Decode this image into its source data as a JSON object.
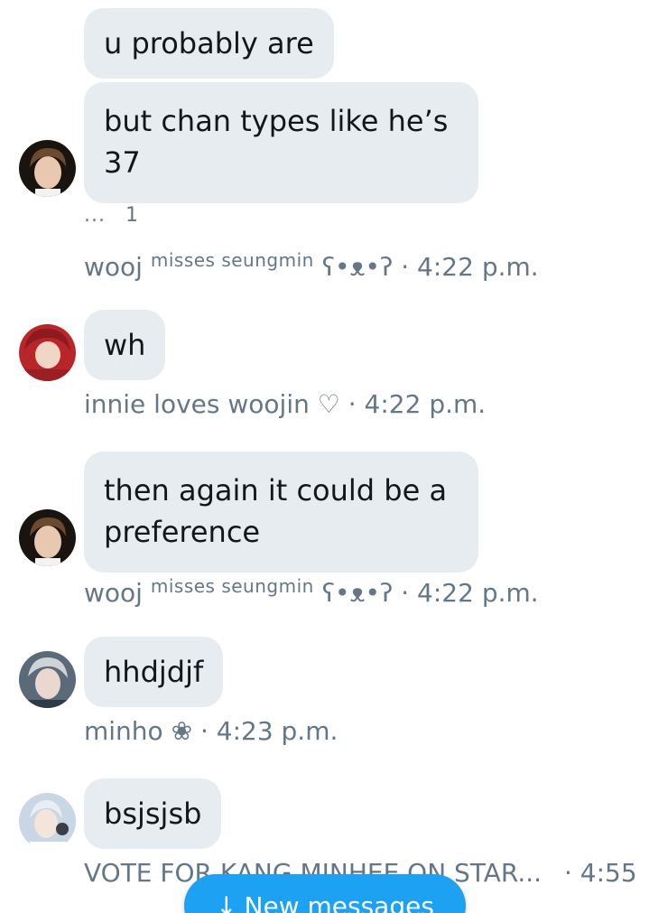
{
  "messages": [
    {
      "bubbles": [
        {
          "lines": [
            "u probably are"
          ]
        },
        {
          "lines": [
            "but chan types like he’s",
            "37"
          ]
        }
      ],
      "reply_dots": "...",
      "reply_count": "1",
      "sender": "wooj",
      "sender_status": "misses seungmin",
      "sender_emoticon": "ʕ•ᴥ•ʔ",
      "time": "· 4:22 p.m."
    },
    {
      "bubbles": [
        {
          "lines": [
            "wh"
          ]
        }
      ],
      "sender": "innie loves woojin ♡",
      "time": "· 4:22 p.m."
    },
    {
      "bubbles": [
        {
          "lines": [
            "then again it could be a",
            "preference"
          ]
        }
      ],
      "sender": "wooj",
      "sender_status": "misses seungmin",
      "sender_emoticon": "ʕ•ᴥ•ʔ",
      "time": "· 4:22 p.m."
    },
    {
      "bubbles": [
        {
          "lines": [
            "hhdjdjf"
          ]
        }
      ],
      "sender": "minho ❀",
      "time": "· 4:23 p.m."
    },
    {
      "bubbles": [
        {
          "lines": [
            "bsjsjsb"
          ]
        }
      ],
      "sender": "VOTE FOR KANG MINHEE ON STAR...",
      "time": "· 4:55"
    }
  ],
  "new_messages_button": {
    "arrow": "↓",
    "label": "New messages"
  },
  "colors": {
    "bubble": "#e6ecf0",
    "meta_text": "#657786",
    "accent": "#1da1f2"
  },
  "icons": [
    "avatar-wooj",
    "avatar-innie",
    "avatar-minho",
    "avatar-kang",
    "down-arrow-icon"
  ]
}
